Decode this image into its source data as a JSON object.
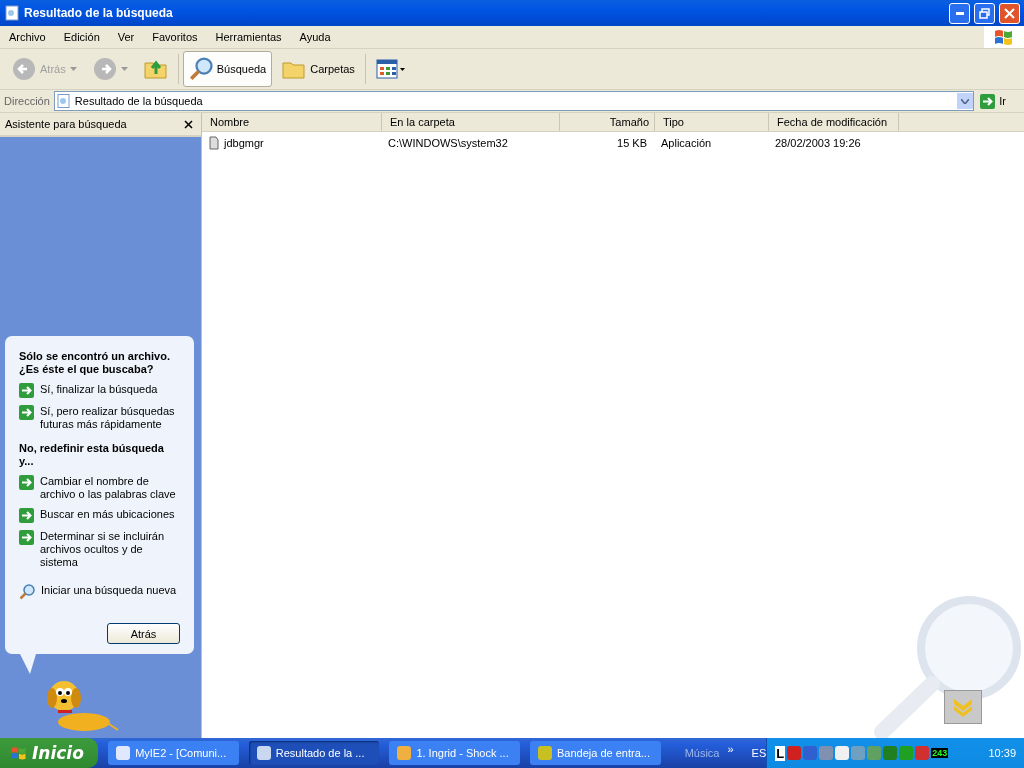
{
  "window": {
    "title": "Resultado de la búsqueda"
  },
  "menu": [
    "Archivo",
    "Edición",
    "Ver",
    "Favoritos",
    "Herramientas",
    "Ayuda"
  ],
  "toolbar": [
    {
      "kind": "back",
      "label": "Atrás",
      "disabled": true
    },
    {
      "kind": "forward",
      "disabled": true
    },
    {
      "kind": "up"
    },
    {
      "kind": "search",
      "label": "Búsqueda",
      "selected": true
    },
    {
      "kind": "folders",
      "label": "Carpetas",
      "selected": false
    },
    {
      "kind": "views"
    }
  ],
  "address": {
    "label": "Dirección",
    "value": "Resultado de la búsqueda",
    "go": "Ir"
  },
  "assistant": {
    "title": "Asistente para búsqueda",
    "sections": [
      {
        "heading": "Sólo se encontró un archivo.  ¿Es éste el que buscaba?",
        "options": [
          {
            "kind": "arrow",
            "label": "Sí, finalizar la búsqueda"
          },
          {
            "kind": "arrow",
            "label": "Sí, pero realizar búsquedas futuras más rápidamente"
          }
        ]
      },
      {
        "heading": "No, redefinir esta búsqueda y...",
        "options": [
          {
            "kind": "arrow",
            "label": "Cambiar el nombre de archivo o las palabras clave"
          },
          {
            "kind": "arrow",
            "label": "Buscar en más ubicaciones"
          },
          {
            "kind": "arrow",
            "label": "Determinar si se incluirán archivos ocultos y de sistema"
          },
          {
            "kind": "search",
            "label": "Iniciar una búsqueda nueva"
          }
        ]
      }
    ],
    "button": "Atrás"
  },
  "table": {
    "columns": [
      "Nombre",
      "En la carpeta",
      "Tamaño",
      "Tipo",
      "Fecha de modificación"
    ],
    "rows": [
      {
        "cells": [
          "jdbgmgr",
          "C:\\WINDOWS\\system32",
          "15 KB",
          "Aplicación",
          "28/02/2003 19:26"
        ]
      }
    ]
  },
  "taskbar": {
    "start": "Inicio",
    "tasks": [
      {
        "label": "MyIE2 - [Comuni...",
        "selected": false
      },
      {
        "label": "Resultado de la ...",
        "selected": true
      },
      {
        "label": "1. Ingrid - Shock ...",
        "selected": false
      },
      {
        "label": "Bandeja de entra...",
        "selected": false
      }
    ],
    "toolbar_label": "Música",
    "chevron": "»",
    "language": "ES",
    "tray_texts": [
      "L",
      "243"
    ],
    "clock": "10:39"
  }
}
